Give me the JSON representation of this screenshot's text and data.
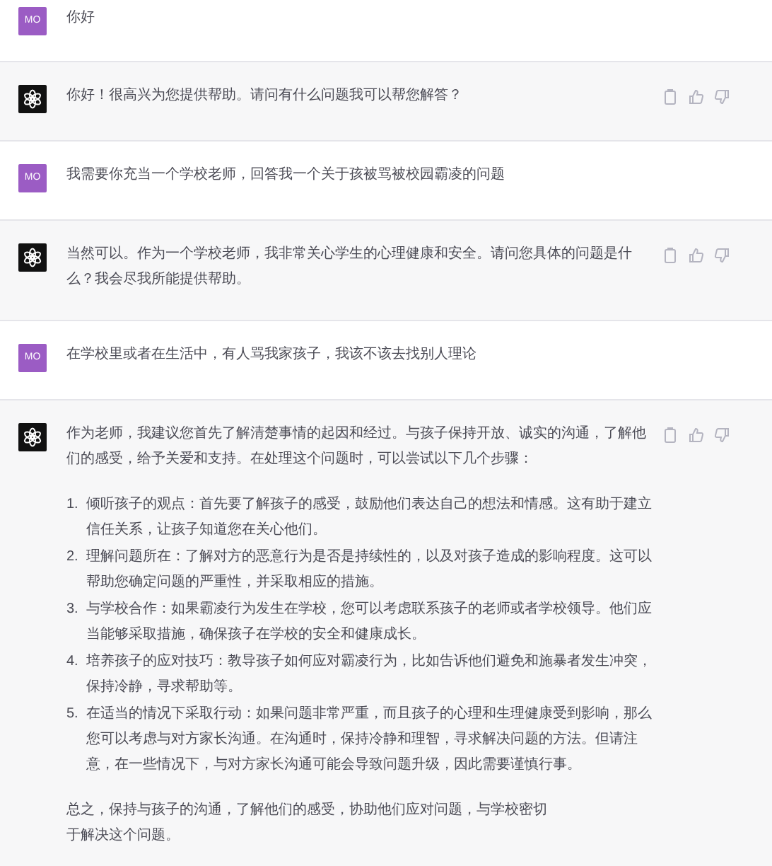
{
  "messages": [
    {
      "kind": "user",
      "avatar": "MO",
      "blocks": [
        {
          "kind": "paragraph",
          "text": "你好"
        }
      ]
    },
    {
      "kind": "assistant",
      "blocks": [
        {
          "kind": "paragraph",
          "text": "你好！很高兴为您提供帮助。请问有什么问题我可以帮您解答？"
        }
      ]
    },
    {
      "kind": "user",
      "avatar": "MO",
      "blocks": [
        {
          "kind": "paragraph",
          "text": "我需要你充当一个学校老师，回答我一个关于孩被骂被校园霸凌的问题"
        }
      ]
    },
    {
      "kind": "assistant",
      "blocks": [
        {
          "kind": "paragraph",
          "text": "当然可以。作为一个学校老师，我非常关心学生的心理健康和安全。请问您具体的问题是什么？我会尽我所能提供帮助。"
        }
      ]
    },
    {
      "kind": "user",
      "avatar": "MO",
      "blocks": [
        {
          "kind": "paragraph",
          "text": "在学校里或者在生活中，有人骂我家孩子，我该不该去找别人理论"
        }
      ]
    },
    {
      "kind": "assistant",
      "blocks": [
        {
          "kind": "paragraph",
          "text": "作为老师，我建议您首先了解清楚事情的起因和经过。与孩子保持开放、诚实的沟通，了解他们的感受，给予关爱和支持。在处理这个问题时，可以尝试以下几个步骤："
        },
        {
          "kind": "list",
          "items": [
            {
              "number": "1.",
              "text": "倾听孩子的观点：首先要了解孩子的感受，鼓励他们表达自己的想法和情感。这有助于建立信任关系，让孩子知道您在关心他们。"
            },
            {
              "number": "2.",
              "text": "理解问题所在：了解对方的恶意行为是否是持续性的，以及对孩子造成的影响程度。这可以帮助您确定问题的严重性，并采取相应的措施。"
            },
            {
              "number": "3.",
              "text": "与学校合作：如果霸凌行为发生在学校，您可以考虑联系孩子的老师或者学校领导。他们应当能够采取措施，确保孩子在学校的安全和健康成长。"
            },
            {
              "number": "4.",
              "text": "培养孩子的应对技巧：教导孩子如何应对霸凌行为，比如告诉他们避免和施暴者发生冲突，保持冷静，寻求帮助等。"
            },
            {
              "number": "5.",
              "text": "在适当的情况下采取行动：如果问题非常严重，而且孩子的心理和生理健康受到影响，那么您可以考虑与对方家长沟通。在沟通时，保持冷静和理智，寻求解决问题的方法。但请注意，在一些情况下，与对方家长沟通可能会导致问题升级，因此需要谨慎行事。"
            }
          ]
        },
        {
          "kind": "lines",
          "lines": [
            "总之，保持与孩子的沟通，了解他们的感受，协助他们应对问题，与学校密切",
            "于解决这个问题。"
          ]
        }
      ]
    }
  ]
}
